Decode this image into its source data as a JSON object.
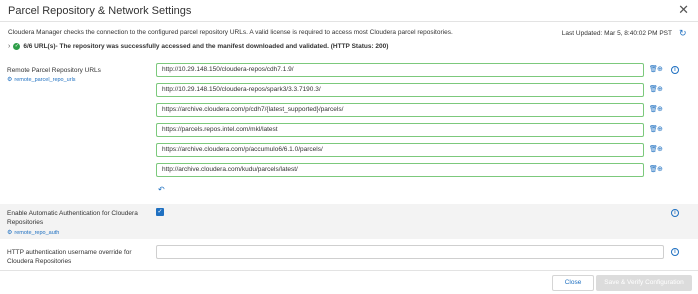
{
  "dialog": {
    "title": "Parcel Repository & Network Settings",
    "close_glyph": "✕"
  },
  "header_info": {
    "description": "Cloudera Manager checks the connection to the configured parcel repository URLs. A valid license is required to access most Cloudera parcel repositories.",
    "last_updated": "Last Updated: Mar 5, 8:40:02 PM PST",
    "status_count": "6/6 URL(s)",
    "status_message": " - The repository was successfully accessed and the manifest downloaded and validated. (HTTP Status: 200)"
  },
  "remote_urls": {
    "label": "Remote Parcel Repository URLs",
    "config_key": "remote_parcel_repo_urls",
    "urls": [
      "http://10.29.148.150/cloudera-repos/cdh7.1.9/",
      "http://10.29.148.150/cloudera-repos/spark3/3.3.7190.3/",
      "https://archive.cloudera.com/p/cdh7/{latest_supported}/parcels/",
      "https://parcels.repos.intel.com/mkl/latest",
      "https://archive.cloudera.com/p/accumulo6/6.1.0/parcels/",
      "http://archive.cloudera.com/kudu/parcels/latest/"
    ]
  },
  "auto_auth": {
    "label": "Enable Automatic Authentication for Cloudera Repositories",
    "config_key": "remote_repo_auth",
    "checked": true
  },
  "http_username": {
    "label": "HTTP authentication username override for Cloudera Repositories",
    "value": ""
  },
  "footer": {
    "close_label": "Close",
    "save_label": "Save & Verify Configuration"
  },
  "icons": {
    "chevron": "›",
    "check": "✓",
    "refresh": "↻",
    "trash": "🗑",
    "add": "⊕",
    "info": "i",
    "undo": "↶",
    "cog": "⚙"
  },
  "colors": {
    "accent": "#1f70c1",
    "success": "#2e9e48",
    "valid_border": "#7cc97c",
    "disabled_button": "#dcdcdc"
  }
}
